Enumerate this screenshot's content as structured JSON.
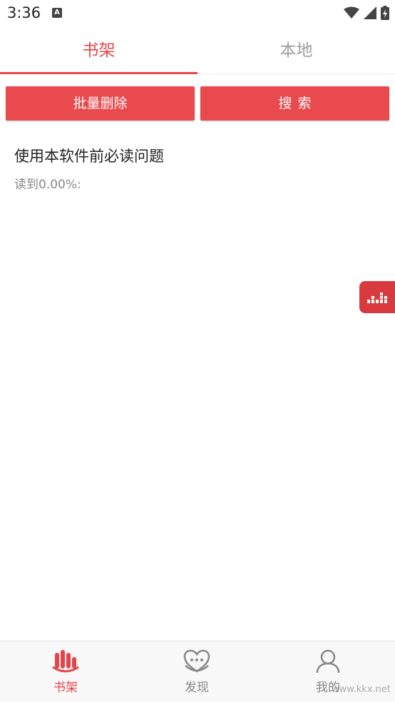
{
  "status_bar": {
    "time": "3:36",
    "app_icon_letter": "A"
  },
  "top_tabs": [
    {
      "label": "书架",
      "active": true
    },
    {
      "label": "本地",
      "active": false
    }
  ],
  "actions": {
    "batch_delete_label": "批量删除",
    "search_label": "搜索"
  },
  "books": [
    {
      "title": "使用本软件前必读问题",
      "progress": "读到0.00%:"
    }
  ],
  "bottom_nav": [
    {
      "label": "书架",
      "icon": "bookshelf-icon",
      "active": true
    },
    {
      "label": "发现",
      "icon": "discover-icon",
      "active": false
    },
    {
      "label": "我的",
      "icon": "profile-icon",
      "active": false
    }
  ],
  "watermark": "www.kkx.net",
  "colors": {
    "accent": "#e5454a",
    "button": "#e84a4d",
    "inactive": "#9e9e9e"
  }
}
